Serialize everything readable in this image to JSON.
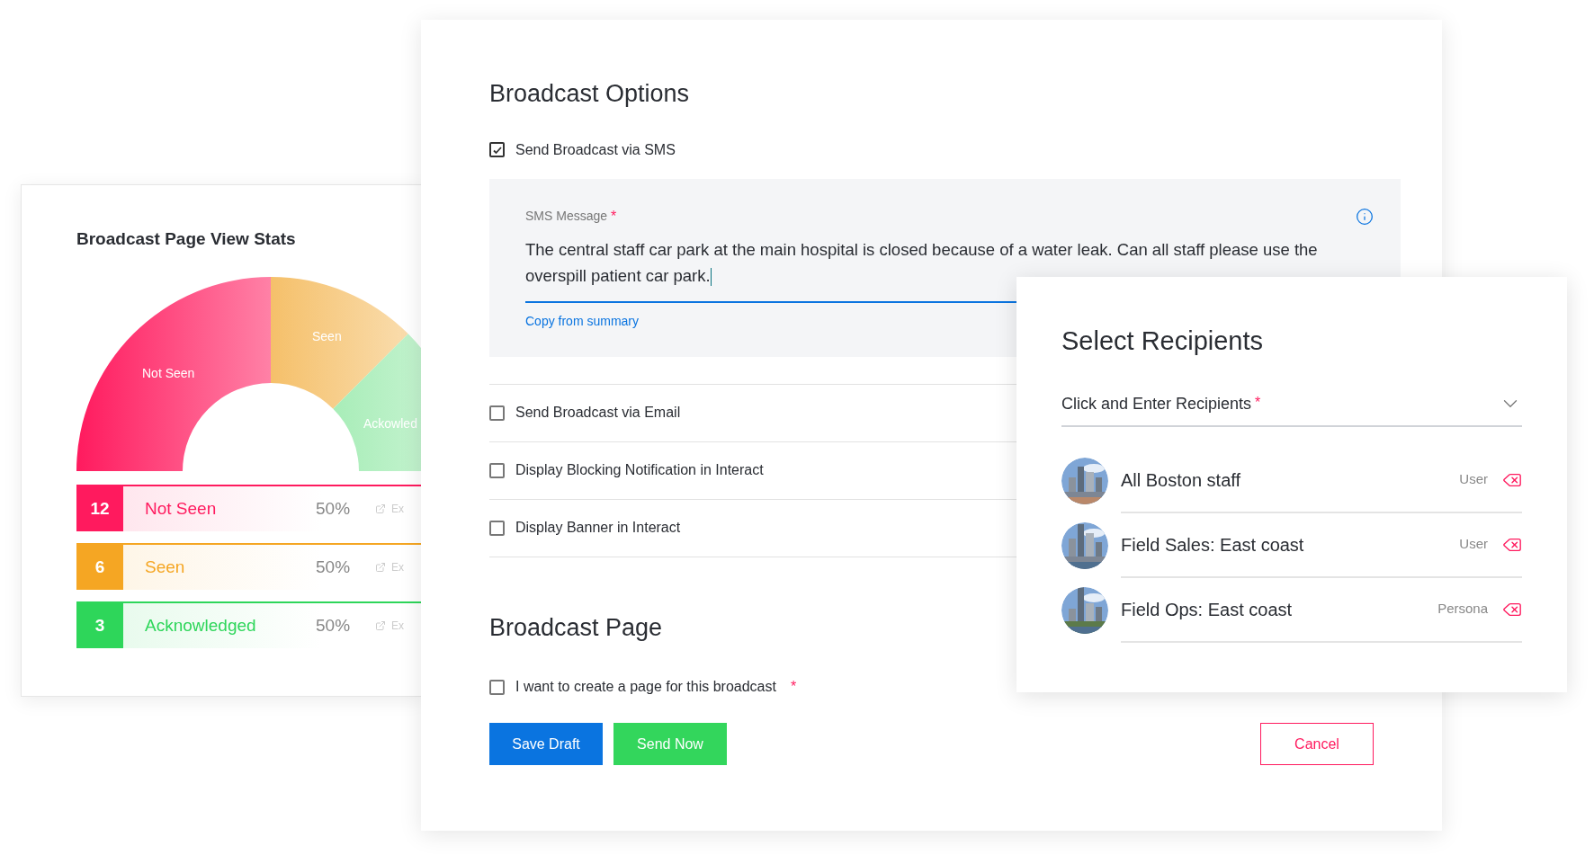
{
  "stats": {
    "title": "Broadcast Page View Stats",
    "slices": [
      {
        "label": "Not Seen",
        "color": "#ff1a5e"
      },
      {
        "label": "Seen",
        "color": "#f5c06a"
      },
      {
        "label": "Ackowled",
        "color": "#a8edb8"
      }
    ],
    "rows": [
      {
        "count": "12",
        "label": "Not Seen",
        "percent": "50%",
        "action": "Ex",
        "color": "#ff1a5e"
      },
      {
        "count": "6",
        "label": "Seen",
        "percent": "50%",
        "action": "Ex",
        "color": "#f5a623"
      },
      {
        "count": "3",
        "label": "Acknowledged",
        "percent": "50%",
        "action": "Ex",
        "color": "#2ed65a"
      }
    ]
  },
  "options": {
    "title": "Broadcast Options",
    "required_mark": "*",
    "sms": {
      "label": "Send Broadcast via SMS",
      "checked": true
    },
    "sms_message": {
      "label": "SMS Message",
      "required": true,
      "value": "The central staff car park at the main hospital is closed because of a water leak. Can all staff please use the overspill patient car park.",
      "link": "Copy from summary"
    },
    "checkboxes": [
      {
        "label": "Send Broadcast via Email",
        "checked": false
      },
      {
        "label": "Display Blocking Notification in Interact",
        "checked": false
      },
      {
        "label": "Display Banner in Interact",
        "checked": false
      }
    ],
    "page_title": "Broadcast Page",
    "page_checkbox": {
      "label": "I want to create a page for this broadcast",
      "checked": false,
      "required": true
    },
    "buttons": [
      {
        "label": "Save Draft",
        "kind": "primary"
      },
      {
        "label": "Send Now",
        "kind": "success"
      },
      {
        "label": "Cancel",
        "kind": "cancel"
      }
    ]
  },
  "recipients": {
    "title": "Select Recipients",
    "placeholder": "Click and Enter Recipients",
    "required": true,
    "items": [
      {
        "name": "All Boston staff",
        "type": "User"
      },
      {
        "name": "Field Sales: East coast",
        "type": "User"
      },
      {
        "name": "Field Ops: East coast",
        "type": "Persona"
      }
    ]
  }
}
